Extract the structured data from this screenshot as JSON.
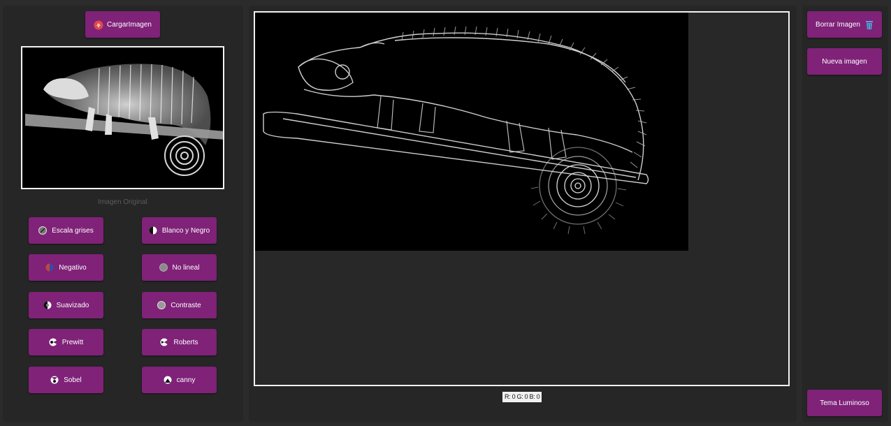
{
  "left": {
    "load_button": {
      "label": "CargarImagen",
      "icon": "load-image-icon"
    },
    "original_caption": "Imagen Original",
    "filters": [
      {
        "label": "Escala grises",
        "icon": "grayscale-icon"
      },
      {
        "label": "Blanco y Negro",
        "icon": "black-white-icon"
      },
      {
        "label": "Negativo",
        "icon": "negative-icon"
      },
      {
        "label": "No lineal",
        "icon": "nonlinear-icon"
      },
      {
        "label": "Suavizado",
        "icon": "smoothing-icon"
      },
      {
        "label": "Contraste",
        "icon": "contrast-icon"
      },
      {
        "label": "Prewitt",
        "icon": "prewitt-icon"
      },
      {
        "label": "Roberts",
        "icon": "roberts-icon"
      },
      {
        "label": "Sobel",
        "icon": "sobel-icon"
      },
      {
        "label": "canny",
        "icon": "canny-icon"
      }
    ]
  },
  "center": {
    "rgb_readout": "R: 0 G: 0 B: 0"
  },
  "right": {
    "delete_button": {
      "label": "Borrar Imagen",
      "icon": "trash-icon"
    },
    "new_button": {
      "label": "Nueva imagen"
    },
    "theme_button": {
      "label": "Tema Luminoso"
    }
  },
  "colors": {
    "accent": "#7f2278",
    "background": "#2b2b2b",
    "panel": "#262626",
    "trash_icon": "#5aa0d8",
    "load_icon": "#e04b4b"
  }
}
